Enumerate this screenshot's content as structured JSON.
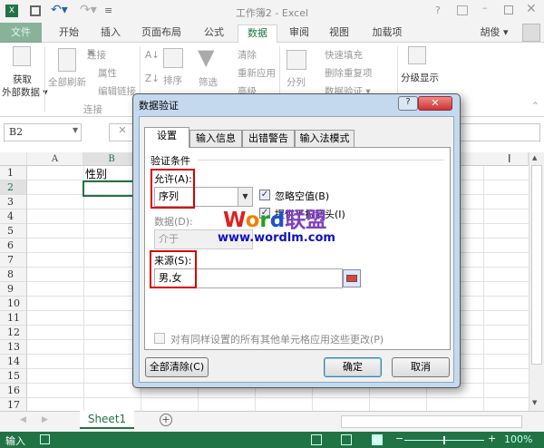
{
  "window": {
    "title": "工作簿2 - Excel",
    "help": "?"
  },
  "tabs": [
    "文件",
    "开始",
    "插入",
    "页面布局",
    "公式",
    "数据",
    "审阅",
    "视图",
    "加载项"
  ],
  "user": "胡俊 ▾",
  "ribbon": {
    "get_external_1": "获取",
    "get_external_2": "外部数据 ▾",
    "refresh_all": "全部刷新",
    "connections": "连接",
    "properties": "属性",
    "edit_links": "编辑链接",
    "group_connections": "连接",
    "sort": "排序",
    "filter": "筛选",
    "clear": "清除",
    "reapply": "重新应用",
    "advanced": "高级",
    "text_to_columns": "分列",
    "flash_fill": "快速填充",
    "remove_duplicates": "删除重复项",
    "data_validation": "数据验证 ▾",
    "outline": "分级显示"
  },
  "formula_bar": {
    "name_box": "B2"
  },
  "grid": {
    "columns": [
      "A",
      "B"
    ],
    "rows": [
      "1",
      "2",
      "3",
      "4",
      "5",
      "6",
      "7",
      "8",
      "9",
      "10",
      "11",
      "12",
      "13",
      "14",
      "15",
      "16",
      "17"
    ],
    "b1": "性别"
  },
  "sheet_tab": "Sheet1",
  "status": {
    "mode": "输入",
    "zoom": "100%"
  },
  "dialog": {
    "title": "数据验证",
    "tabs": [
      "设置",
      "输入信息",
      "出错警告",
      "输入法模式"
    ],
    "section": "验证条件",
    "allow_label": "允许(A):",
    "allow_value": "序列",
    "ignore_blank": "忽略空值(B)",
    "dropdown": "提供下拉箭头(I)",
    "data_label": "数据(D):",
    "data_value": "介于",
    "source_label": "来源(S):",
    "source_value": "男,女",
    "apply_all": "对有同样设置的所有其他单元格应用这些更改(P)",
    "clear_all": "全部清除(C)",
    "ok": "确定",
    "cancel": "取消"
  },
  "watermark": {
    "line1": "Word联盟",
    "line2": "www.wordlm.com"
  },
  "colors": {
    "excel_green": "#217346",
    "highlight": "#d60000"
  }
}
